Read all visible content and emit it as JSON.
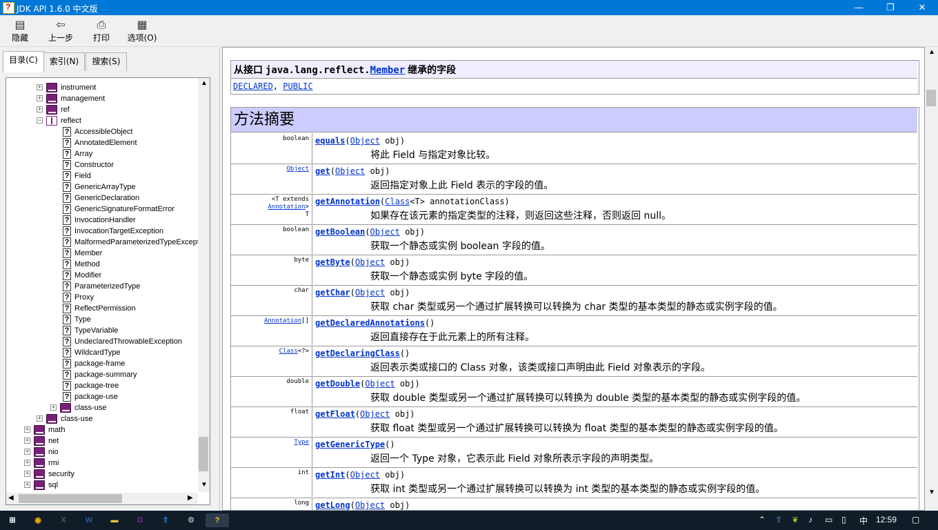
{
  "window": {
    "title": "JDK API 1.6.0 中文版",
    "minimize": "—",
    "maximize": "❐",
    "close": "✕"
  },
  "toolbar": {
    "hide": {
      "label": "隐藏",
      "icon": "hide-icon"
    },
    "back": {
      "label": "上一步",
      "icon": "back-arrow-icon"
    },
    "print": {
      "label": "打印",
      "icon": "printer-icon"
    },
    "options": {
      "label": "选项(O)",
      "icon": "options-icon"
    }
  },
  "tabs": {
    "contents": "目录(C)",
    "index": "索引(N)",
    "search": "搜索(S)"
  },
  "tree": {
    "packages_before": [
      "instrument",
      "management",
      "ref"
    ],
    "open_package": "reflect",
    "reflect_children": [
      "AccessibleObject",
      "AnnotatedElement",
      "Array",
      "Constructor",
      "Field",
      "GenericArrayType",
      "GenericDeclaration",
      "GenericSignatureFormatError",
      "InvocationHandler",
      "InvocationTargetException",
      "MalformedParameterizedTypeExcepti",
      "Member",
      "Method",
      "Modifier",
      "ParameterizedType",
      "Proxy",
      "ReflectPermission",
      "Type",
      "TypeVariable",
      "UndeclaredThrowableException",
      "WildcardType",
      "package-frame",
      "package-summary",
      "package-tree",
      "package-use"
    ],
    "reflect_class_use": "class-use",
    "lang_class_use": "class-use",
    "top_packages": [
      "math",
      "net",
      "nio",
      "rmi",
      "security",
      "sql"
    ]
  },
  "content": {
    "inherited": {
      "prefix": "从接口 ",
      "pkg": "java.lang.reflect.",
      "iface": "Member",
      "suffix": " 继承的字段",
      "field1": "DECLARED",
      "sep": ", ",
      "field2": "PUBLIC"
    },
    "summary_title": "方法摘要",
    "methods": [
      {
        "type_pre": "boolean",
        "type_link": "",
        "name": "equals",
        "params_pre": "(",
        "param_link": "Object",
        "params_post": " obj)",
        "desc": "将此 Field 与指定对象比较。"
      },
      {
        "type_pre": "",
        "type_link": "Object",
        "name": "get",
        "params_pre": "(",
        "param_link": "Object",
        "params_post": " obj)",
        "desc": "返回指定对象上此 Field 表示的字段的值。"
      },
      {
        "type_pre": "<T extends ",
        "type_link": "Annotation",
        "type_post": ">\nT",
        "name": "getAnnotation",
        "params_pre": "(",
        "param_link": "Class",
        "params_post": "<T> annotationClass)",
        "desc": "如果存在该元素的指定类型的注释，则返回这些注释，否则返回 null。"
      },
      {
        "type_pre": "boolean",
        "type_link": "",
        "name": "getBoolean",
        "params_pre": "(",
        "param_link": "Object",
        "params_post": " obj)",
        "desc": "获取一个静态或实例 boolean 字段的值。"
      },
      {
        "type_pre": "byte",
        "type_link": "",
        "name": "getByte",
        "params_pre": "(",
        "param_link": "Object",
        "params_post": " obj)",
        "desc": "获取一个静态或实例 byte 字段的值。"
      },
      {
        "type_pre": "char",
        "type_link": "",
        "name": "getChar",
        "params_pre": "(",
        "param_link": "Object",
        "params_post": " obj)",
        "desc": "获取 char 类型或另一个通过扩展转换可以转换为 char 类型的基本类型的静态或实例字段的值。"
      },
      {
        "type_pre": "",
        "type_link": "Annotation",
        "type_post": "[]",
        "name": "getDeclaredAnnotations",
        "params_pre": "()",
        "param_link": "",
        "params_post": "",
        "desc": "返回直接存在于此元素上的所有注释。"
      },
      {
        "type_pre": "",
        "type_link": "Class",
        "type_post": "<?>",
        "name": "getDeclaringClass",
        "params_pre": "()",
        "param_link": "",
        "params_post": "",
        "desc": "返回表示类或接口的 Class 对象，该类或接口声明由此 Field 对象表示的字段。"
      },
      {
        "type_pre": "double",
        "type_link": "",
        "name": "getDouble",
        "params_pre": "(",
        "param_link": "Object",
        "params_post": " obj)",
        "desc": "获取 double 类型或另一个通过扩展转换可以转换为 double 类型的基本类型的静态或实例字段的值。"
      },
      {
        "type_pre": "float",
        "type_link": "",
        "name": "getFloat",
        "params_pre": "(",
        "param_link": "Object",
        "params_post": " obj)",
        "desc": "获取 float 类型或另一个通过扩展转换可以转换为 float 类型的基本类型的静态或实例字段的值。"
      },
      {
        "type_pre": "",
        "type_link": "Type",
        "name": "getGenericType",
        "params_pre": "()",
        "param_link": "",
        "params_post": "",
        "desc": "返回一个 Type 对象，它表示此 Field 对象所表示字段的声明类型。"
      },
      {
        "type_pre": "int",
        "type_link": "",
        "name": "getInt",
        "params_pre": "(",
        "param_link": "Object",
        "params_post": " obj)",
        "desc": "获取 int 类型或另一个通过扩展转换可以转换为 int 类型的基本类型的静态或实例字段的值。"
      },
      {
        "type_pre": "long",
        "type_link": "",
        "name": "getLong",
        "params_pre": "(",
        "param_link": "Object",
        "params_post": " obj)",
        "desc": ""
      }
    ]
  },
  "taskbar": {
    "apps": [
      {
        "icon": "windows-start-icon",
        "glyph": "⊞",
        "color": "#ffffff"
      },
      {
        "icon": "chrome-icon",
        "glyph": "◉",
        "color": "#e8b300"
      },
      {
        "icon": "excel-icon",
        "glyph": "X",
        "color": "#1e7145"
      },
      {
        "icon": "word-icon",
        "glyph": "W",
        "color": "#2b579a"
      },
      {
        "icon": "file-explorer-icon",
        "glyph": "▬",
        "color": "#f0c040"
      },
      {
        "icon": "app-g-icon",
        "glyph": "G",
        "color": "#7b2d8e"
      },
      {
        "icon": "upload-app-icon",
        "glyph": "⇧",
        "color": "#1e88e5"
      },
      {
        "icon": "settings-app-icon",
        "glyph": "⚙",
        "color": "#aaaaaa"
      },
      {
        "icon": "help-viewer-icon",
        "glyph": "?",
        "color": "#f5c518"
      }
    ],
    "tray": {
      "ime": "中",
      "time": "12:59"
    }
  }
}
